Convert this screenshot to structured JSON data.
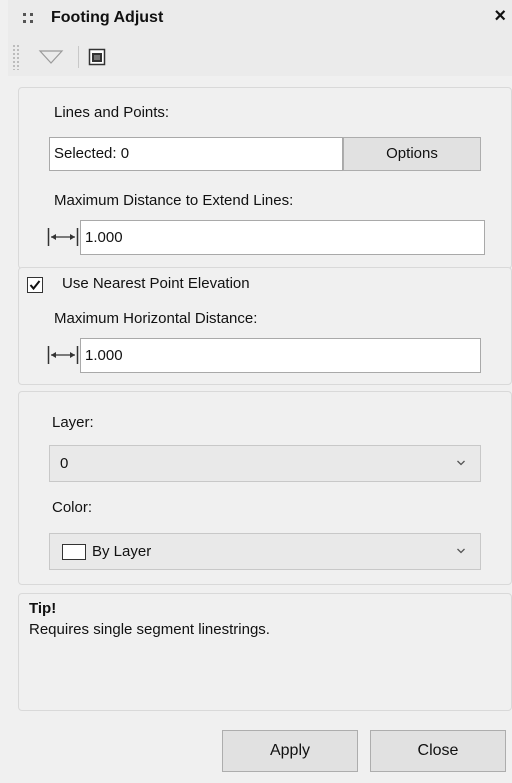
{
  "window": {
    "title": "Footing Adjust",
    "close_glyph": "×"
  },
  "toolbar": {
    "buttons": [
      {
        "icon": "triangle-down-icon"
      },
      {
        "icon": "window-icon"
      }
    ]
  },
  "lines_points": {
    "label": "Lines and Points:",
    "selected_value": "Selected: 0",
    "options_label": "Options",
    "max_distance_label": "Maximum Distance to Extend Lines:",
    "max_distance_value": "1.000"
  },
  "nearest_point": {
    "checkbox_label": "Use Nearest Point Elevation",
    "checked": true,
    "max_horizontal_label": "Maximum Horizontal Distance:",
    "max_horizontal_value": "1.000"
  },
  "layer_color": {
    "layer_label": "Layer:",
    "layer_value": "0",
    "color_label": "Color:",
    "color_value": "By Layer"
  },
  "tip": {
    "title": "Tip!",
    "text": "Requires single segment linestrings."
  },
  "buttons": {
    "apply_label": "Apply",
    "close_label": "Close"
  },
  "colors": {
    "panel_bg": "#f0f0f0",
    "titlebar_bg": "#ebebeb",
    "input_bg": "#ffffff",
    "button_bg": "#e1e1e1"
  }
}
